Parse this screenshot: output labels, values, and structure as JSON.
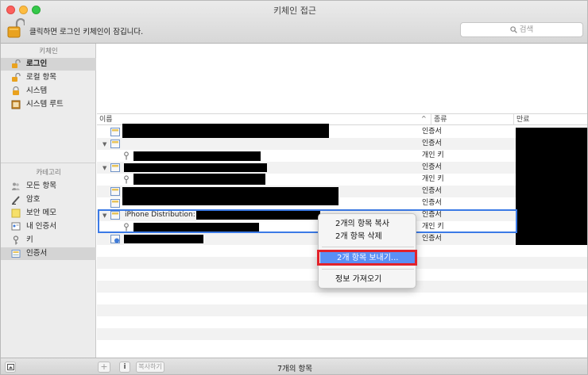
{
  "window": {
    "title": "키체인 접근",
    "lock_message": "클릭하면 로그인 키체인이 잠깁니다.",
    "search_placeholder": "검색"
  },
  "sidebar": {
    "keychains_header": "키체인",
    "keychains": [
      {
        "label": "로그인",
        "icon": "lock-open-icon",
        "selected": true
      },
      {
        "label": "로컬 항목",
        "icon": "lock-open-icon",
        "selected": false
      },
      {
        "label": "시스템",
        "icon": "lock-icon",
        "selected": false
      },
      {
        "label": "시스템 루트",
        "icon": "cabinet-icon",
        "selected": false
      }
    ],
    "categories_header": "카테고리",
    "categories": [
      {
        "label": "모든 항목",
        "icon": "people-icon",
        "selected": false
      },
      {
        "label": "암호",
        "icon": "pencil-icon",
        "selected": false
      },
      {
        "label": "보안 메모",
        "icon": "note-icon",
        "selected": false
      },
      {
        "label": "내 인증서",
        "icon": "my-certificate-icon",
        "selected": false
      },
      {
        "label": "키",
        "icon": "key-icon",
        "selected": false
      },
      {
        "label": "인증서",
        "icon": "certificate-icon",
        "selected": true
      }
    ]
  },
  "table": {
    "columns": {
      "name": "이름",
      "kind": "종류",
      "expires": "만료"
    },
    "rows": [
      {
        "kind": "인증서",
        "name": ""
      },
      {
        "kind": "인증서",
        "name": ""
      },
      {
        "kind": "개인 키",
        "name": ""
      },
      {
        "kind": "인증서",
        "name": ""
      },
      {
        "kind": "개인 키",
        "name": ""
      },
      {
        "kind": "인증서",
        "name": ""
      },
      {
        "kind": "인증서",
        "name": ""
      },
      {
        "kind": "인증서",
        "name": "iPhone Distribution:"
      },
      {
        "kind": "개인 키",
        "name": ""
      },
      {
        "kind": "인증서",
        "name": ""
      }
    ]
  },
  "context_menu": {
    "items": [
      {
        "label": "2개의 항목 복사",
        "highlighted": false
      },
      {
        "label": "2개 항목 삭제",
        "highlighted": false
      },
      {
        "label": "2개 항목 보내기...",
        "highlighted": true
      },
      {
        "label": "정보 가져오기",
        "highlighted": false
      }
    ]
  },
  "statusbar": {
    "add_label": "+",
    "info_label": "i",
    "copy_label": "복사하기",
    "item_count": "7개의 항목"
  },
  "colors": {
    "selection_accent": "#3b7ae6",
    "menu_highlight": "#5a8ff5",
    "callout_red": "#e2222b"
  }
}
